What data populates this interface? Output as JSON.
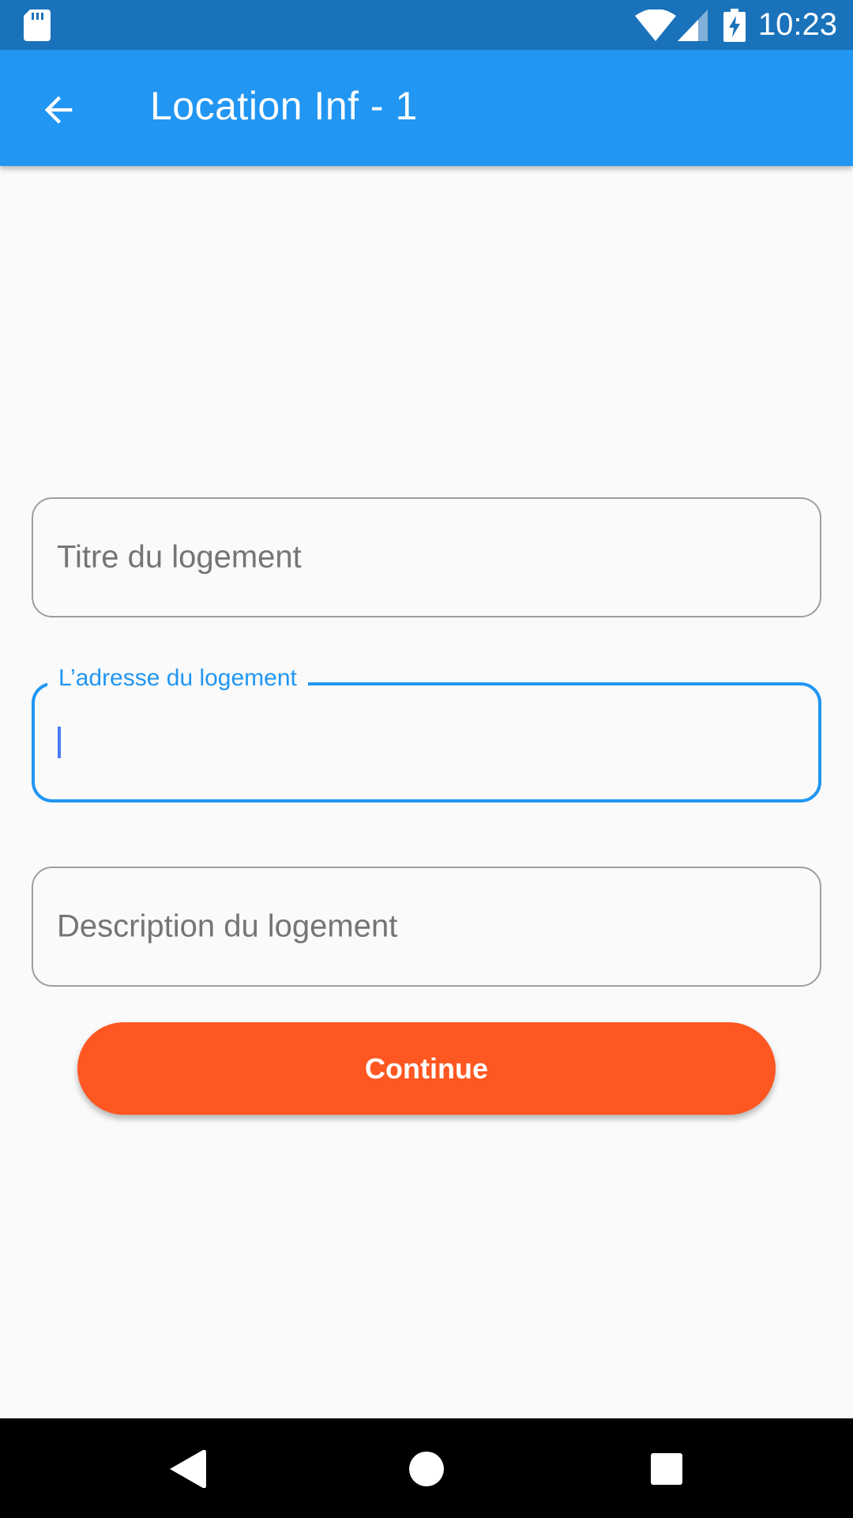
{
  "status_bar": {
    "time": "10:23",
    "icons": [
      "sd-card-icon",
      "wifi-icon",
      "signal-icon",
      "battery-charging-icon"
    ]
  },
  "app_bar": {
    "title": "Location Inf - 1",
    "back_icon": "arrow-back-icon",
    "background_color": "#2196f3"
  },
  "form": {
    "title_field": {
      "placeholder": "Titre du logement",
      "value": ""
    },
    "address_field": {
      "label": "L’adresse du logement",
      "value": "",
      "focused": true
    },
    "description_field": {
      "placeholder": "Description du logement",
      "value": ""
    },
    "continue_label": "Continue",
    "accent_color": "#2196f3",
    "button_color": "#ff5722"
  },
  "nav_bar": {
    "icons": [
      "nav-back-icon",
      "nav-home-icon",
      "nav-recents-icon"
    ]
  }
}
